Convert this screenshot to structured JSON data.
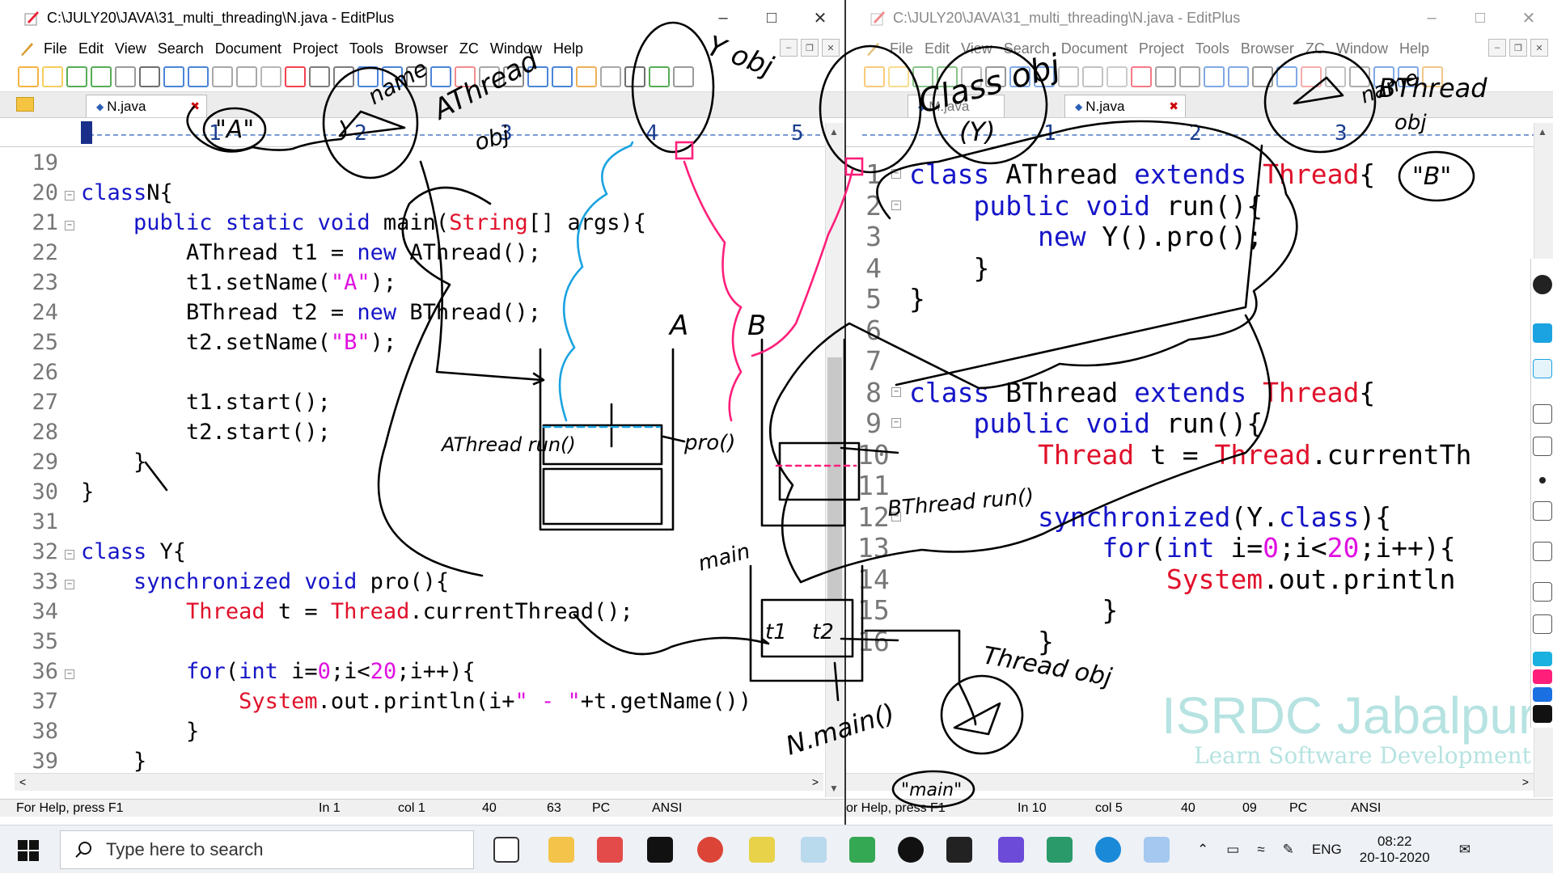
{
  "left_window": {
    "title": "C:\\JULY20\\JAVA\\31_multi_threading\\N.java - EditPlus",
    "menu": [
      "File",
      "Edit",
      "View",
      "Search",
      "Document",
      "Project",
      "Tools",
      "Browser",
      "ZC",
      "Window",
      "Help"
    ],
    "tab": "N.java",
    "ruler": [
      "1",
      "2",
      "3",
      "4",
      "5"
    ],
    "lines": [
      {
        "n": "19",
        "fold": false,
        "parts": []
      },
      {
        "n": "20",
        "fold": true,
        "parts": [
          [
            "kw",
            "class"
          ],
          [
            "",
            "N{"
          ]
        ]
      },
      {
        "n": "21",
        "fold": true,
        "parts": [
          [
            "",
            "    "
          ],
          [
            "kw",
            "public static void"
          ],
          [
            "",
            " main("
          ],
          [
            "ty",
            "String"
          ],
          [
            "",
            "[] args){"
          ]
        ]
      },
      {
        "n": "22",
        "fold": false,
        "parts": [
          [
            "",
            "        AThread t1 = "
          ],
          [
            "kw",
            "new"
          ],
          [
            "",
            " AThread();"
          ]
        ]
      },
      {
        "n": "23",
        "fold": false,
        "parts": [
          [
            "",
            "        t1.setName("
          ],
          [
            "st",
            "\"A\""
          ],
          [
            "",
            ");"
          ]
        ]
      },
      {
        "n": "24",
        "fold": false,
        "parts": [
          [
            "",
            "        BThread t2 = "
          ],
          [
            "kw",
            "new"
          ],
          [
            "",
            " BThread();"
          ]
        ]
      },
      {
        "n": "25",
        "fold": false,
        "parts": [
          [
            "",
            "        t2.setName("
          ],
          [
            "st",
            "\"B\""
          ],
          [
            "",
            ");"
          ]
        ]
      },
      {
        "n": "26",
        "fold": false,
        "parts": []
      },
      {
        "n": "27",
        "fold": false,
        "parts": [
          [
            "",
            "        t1.start();"
          ]
        ]
      },
      {
        "n": "28",
        "fold": false,
        "parts": [
          [
            "",
            "        t2.start();"
          ]
        ]
      },
      {
        "n": "29",
        "fold": false,
        "parts": [
          [
            "",
            "    }"
          ]
        ]
      },
      {
        "n": "30",
        "fold": false,
        "parts": [
          [
            "",
            "}"
          ]
        ]
      },
      {
        "n": "31",
        "fold": false,
        "parts": []
      },
      {
        "n": "32",
        "fold": true,
        "parts": [
          [
            "kw",
            "class"
          ],
          [
            "",
            " Y{"
          ]
        ]
      },
      {
        "n": "33",
        "fold": true,
        "parts": [
          [
            "",
            "    "
          ],
          [
            "kw",
            "synchronized void"
          ],
          [
            "",
            " pro(){"
          ]
        ]
      },
      {
        "n": "34",
        "fold": false,
        "parts": [
          [
            "",
            "        "
          ],
          [
            "ty",
            "Thread"
          ],
          [
            "",
            " t = "
          ],
          [
            "ty",
            "Thread"
          ],
          [
            "",
            ".currentThread();"
          ]
        ]
      },
      {
        "n": "35",
        "fold": false,
        "parts": []
      },
      {
        "n": "36",
        "fold": true,
        "parts": [
          [
            "",
            "        "
          ],
          [
            "kw",
            "for"
          ],
          [
            "",
            "("
          ],
          [
            "kw",
            "int"
          ],
          [
            "",
            " i="
          ],
          [
            "nm",
            "0"
          ],
          [
            "",
            ";i<"
          ],
          [
            "nm",
            "20"
          ],
          [
            "",
            ";i++){"
          ]
        ]
      },
      {
        "n": "37",
        "fold": false,
        "parts": [
          [
            "",
            "            "
          ],
          [
            "ty",
            "System"
          ],
          [
            "",
            ".out.println(i+"
          ],
          [
            "st",
            "\" - \""
          ],
          [
            "",
            "+t.getName())"
          ]
        ]
      },
      {
        "n": "38",
        "fold": false,
        "parts": [
          [
            "",
            "        }"
          ]
        ]
      },
      {
        "n": "39",
        "fold": false,
        "parts": [
          [
            "",
            "    }"
          ]
        ]
      }
    ],
    "status": {
      "help": "For Help, press F1",
      "ln": "In 1",
      "col": "col 1",
      "a": "40",
      "b": "63",
      "mode": "PC",
      "enc": "ANSI"
    }
  },
  "right_window": {
    "title": "C:\\JULY20\\JAVA\\31_multi_threading\\N.java - EditPlus",
    "menu": [
      "File",
      "Edit",
      "View",
      "Search",
      "Document",
      "Project",
      "Tools",
      "Browser",
      "ZC",
      "Window",
      "Help"
    ],
    "tabs": [
      "M.java",
      "N.java"
    ],
    "ruler": [
      "1",
      "2",
      "3"
    ],
    "lines": [
      {
        "n": "1",
        "fold": true,
        "parts": [
          [
            "kw",
            "class"
          ],
          [
            "",
            " AThread "
          ],
          [
            "kw",
            "extends"
          ],
          [
            "",
            " "
          ],
          [
            "ty",
            "Thread"
          ],
          [
            "",
            "{"
          ]
        ]
      },
      {
        "n": "2",
        "fold": true,
        "parts": [
          [
            "",
            "    "
          ],
          [
            "kw",
            "public void"
          ],
          [
            "",
            " run(){"
          ]
        ]
      },
      {
        "n": "3",
        "fold": false,
        "parts": [
          [
            "",
            "        "
          ],
          [
            "kw",
            "new"
          ],
          [
            "",
            " Y().pro();"
          ]
        ]
      },
      {
        "n": "4",
        "fold": false,
        "parts": [
          [
            "",
            "    }"
          ]
        ]
      },
      {
        "n": "5",
        "fold": false,
        "parts": [
          [
            "",
            "}"
          ]
        ]
      },
      {
        "n": "6",
        "fold": false,
        "parts": []
      },
      {
        "n": "7",
        "fold": false,
        "parts": []
      },
      {
        "n": "8",
        "fold": true,
        "parts": [
          [
            "kw",
            "class"
          ],
          [
            "",
            " BThread "
          ],
          [
            "kw",
            "extends"
          ],
          [
            "",
            " "
          ],
          [
            "ty",
            "Thread"
          ],
          [
            "",
            "{"
          ]
        ]
      },
      {
        "n": "9",
        "fold": true,
        "parts": [
          [
            "",
            "    "
          ],
          [
            "kw",
            "public void"
          ],
          [
            "",
            " run(){"
          ]
        ]
      },
      {
        "n": "10",
        "fold": false,
        "parts": [
          [
            "",
            "        "
          ],
          [
            "ty",
            "Thread"
          ],
          [
            "",
            " t = "
          ],
          [
            "ty",
            "Thread"
          ],
          [
            "",
            ".currentTh"
          ]
        ]
      },
      {
        "n": "11",
        "fold": false,
        "parts": []
      },
      {
        "n": "12",
        "fold": true,
        "parts": [
          [
            "",
            "        "
          ],
          [
            "kw",
            "synchronized"
          ],
          [
            "",
            "(Y."
          ],
          [
            "kw",
            "class"
          ],
          [
            "",
            "){"
          ]
        ]
      },
      {
        "n": "13",
        "fold": false,
        "parts": [
          [
            "",
            "            "
          ],
          [
            "kw",
            "for"
          ],
          [
            "",
            "("
          ],
          [
            "kw",
            "int"
          ],
          [
            "",
            " i="
          ],
          [
            "nm",
            "0"
          ],
          [
            "",
            ";i<"
          ],
          [
            "nm",
            "20"
          ],
          [
            "",
            ";i++){"
          ]
        ]
      },
      {
        "n": "14",
        "fold": false,
        "parts": [
          [
            "",
            "                "
          ],
          [
            "ty",
            "System"
          ],
          [
            "",
            ".out.println"
          ]
        ]
      },
      {
        "n": "15",
        "fold": false,
        "parts": [
          [
            "",
            "            }"
          ]
        ]
      },
      {
        "n": "16",
        "fold": false,
        "parts": [
          [
            "",
            "        }"
          ]
        ]
      }
    ],
    "status": {
      "help": "or Help, press F1",
      "ln": "In 10",
      "col": "col 5",
      "a": "40",
      "b": "09",
      "mode": "PC",
      "enc": "ANSI"
    }
  },
  "watermark": {
    "name": "ISRDC Jabalpur",
    "tagline": "Learn Software Development"
  },
  "annotations": {
    "left_name": "name",
    "left_athread": "AThread",
    "left_obj": "obj",
    "a_quote": "\"A\"",
    "y_obj": "Y obj",
    "class_obj": "Class obj",
    "y_paren": "(Y)",
    "b_name": "name",
    "b_bthread": "BThread",
    "b_obj": "obj",
    "b_quote": "\"B\"",
    "athread_run": "AThread run()",
    "pro": "pro()",
    "label_a": "A",
    "label_b": "B",
    "bthread_run": "BThread run()",
    "main": "main",
    "n_main": "N.main()",
    "thread_obj": "Thread obj",
    "main_quote": "\"main\"",
    "t1": "t1",
    "t2": "t2"
  },
  "taskbar": {
    "search_placeholder": "Type here to search",
    "lang": "ENG",
    "time": "08:22",
    "date": "20-10-2020"
  },
  "colors": {
    "keyword": "#1515c8",
    "type": "#e0102a",
    "string": "#e010e0",
    "ink": "#000000",
    "pink": "#ff1f7a",
    "cyan": "#1aa3e0"
  }
}
